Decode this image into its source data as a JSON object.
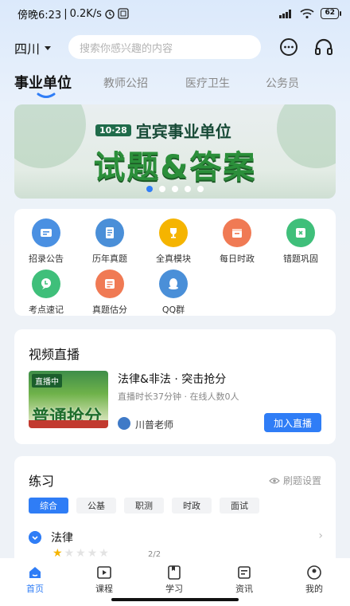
{
  "status_bar": {
    "time": "傍晚6:23",
    "speed": "0.2K/s",
    "battery": "62"
  },
  "header": {
    "city": "四川",
    "search_placeholder": "搜索你感兴趣的内容"
  },
  "tabs": [
    {
      "label": "事业单位",
      "active": true
    },
    {
      "label": "教师公招"
    },
    {
      "label": "医疗卫生"
    },
    {
      "label": "公务员"
    }
  ],
  "banner": {
    "badge": "10·28",
    "subtitle": "宜宾事业单位",
    "title": "试题&答案",
    "dots_total": 5,
    "dots_active": 0
  },
  "grid": [
    {
      "label": "招录公告",
      "icon": "notice-icon",
      "color": "#4a90e2"
    },
    {
      "label": "历年真题",
      "icon": "exam-paper-icon",
      "color": "#4a8fd8"
    },
    {
      "label": "全真模块",
      "icon": "trophy-icon",
      "color": "#f5b400"
    },
    {
      "label": "每日时政",
      "icon": "calendar-icon",
      "color": "#f07a54"
    },
    {
      "label": "错题巩固",
      "icon": "error-book-icon",
      "color": "#3fbf7a"
    },
    {
      "label": "考点速记",
      "icon": "chat-bubble-icon",
      "color": "#3fbf7a"
    },
    {
      "label": "真题估分",
      "icon": "score-sheet-icon",
      "color": "#f07a54"
    },
    {
      "label": "QQ群",
      "icon": "qq-icon",
      "color": "#4a8fd8"
    }
  ],
  "video": {
    "section_title": "视频直播",
    "thumb_live": "直播中",
    "thumb_text": "普通抢分",
    "title": "法律&非法 · 突击抢分",
    "meta": "直播时长37分钟 · 在线人数0人",
    "teacher": "川普老师",
    "join_label": "加入直播"
  },
  "practice": {
    "section_title": "练习",
    "settings_label": "刷题设置",
    "chips": [
      {
        "label": "综合",
        "active": true
      },
      {
        "label": "公基"
      },
      {
        "label": "职测"
      },
      {
        "label": "时政"
      },
      {
        "label": "面试"
      }
    ],
    "row": {
      "title": "法律",
      "stars_filled": 1,
      "stars_total": 5,
      "count": "2/2"
    }
  },
  "nav": [
    {
      "label": "首页",
      "icon": "home-icon",
      "active": true
    },
    {
      "label": "课程",
      "icon": "play-icon"
    },
    {
      "label": "学习",
      "icon": "book-icon"
    },
    {
      "label": "资讯",
      "icon": "news-icon"
    },
    {
      "label": "我的",
      "icon": "user-icon"
    }
  ],
  "colors": {
    "accent": "#2f7df6",
    "banner_green": "#2b8f3a"
  }
}
